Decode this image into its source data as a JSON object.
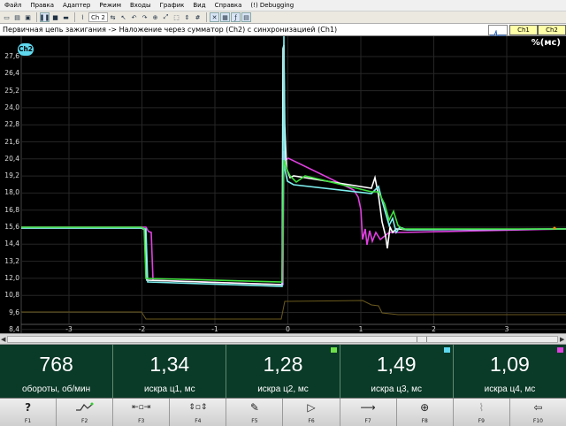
{
  "menu": [
    "Файл",
    "Правка",
    "Адаптер",
    "Режим",
    "Входы",
    "График",
    "Вид",
    "Справка",
    "(!) Debugging"
  ],
  "toolbar": {
    "channel": "Ch 2"
  },
  "info": {
    "title": "Первичная цепь зажигания -> Наложение через сумматор (Ch2) с синхронизацией (Ch1)",
    "ch1": "Ch1",
    "ch2": "Ch2"
  },
  "plot": {
    "unit": "%(мс)",
    "badge": "Ch2",
    "y_ticks": [
      "27,6",
      "26,4",
      "25,2",
      "24,0",
      "22,8",
      "21,6",
      "20,4",
      "19,2",
      "18,0",
      "16,8",
      "15,6",
      "14,4",
      "13,2",
      "12,0",
      "10,8",
      "9,6",
      "8,4"
    ],
    "x_ticks": [
      "-3",
      "-2",
      "-1",
      "0",
      "1",
      "2",
      "3"
    ]
  },
  "readouts": [
    {
      "value": "768",
      "label": "обороты, об/мин",
      "color": ""
    },
    {
      "value": "1,34",
      "label": "искра ц1, мс",
      "color": ""
    },
    {
      "value": "1,28",
      "label": "искра ц2, мс",
      "color": "#6ee04a"
    },
    {
      "value": "1,49",
      "label": "искра ц3, мс",
      "color": "#5fd8ee"
    },
    {
      "value": "1,09",
      "label": "искра ц4, мс",
      "color": "#e040e0"
    }
  ],
  "fkeys": [
    {
      "key": "F1",
      "icon": "help-icon"
    },
    {
      "key": "F2",
      "icon": "trigger-icon"
    },
    {
      "key": "F3",
      "icon": "timebase-icon"
    },
    {
      "key": "F4",
      "icon": "amplitude-icon"
    },
    {
      "key": "F5",
      "icon": "brush-icon"
    },
    {
      "key": "F6",
      "icon": "play-icon"
    },
    {
      "key": "F7",
      "icon": "arrow-right-icon"
    },
    {
      "key": "F8",
      "icon": "crosshair-icon"
    },
    {
      "key": "F9",
      "icon": "filter-icon"
    },
    {
      "key": "F10",
      "icon": "exit-icon"
    }
  ],
  "colors": {
    "ch_green": "#3ee03e",
    "ch_cyan": "#7ff0f0",
    "ch_magenta": "#e040e0",
    "ch_white": "#ffffff"
  }
}
